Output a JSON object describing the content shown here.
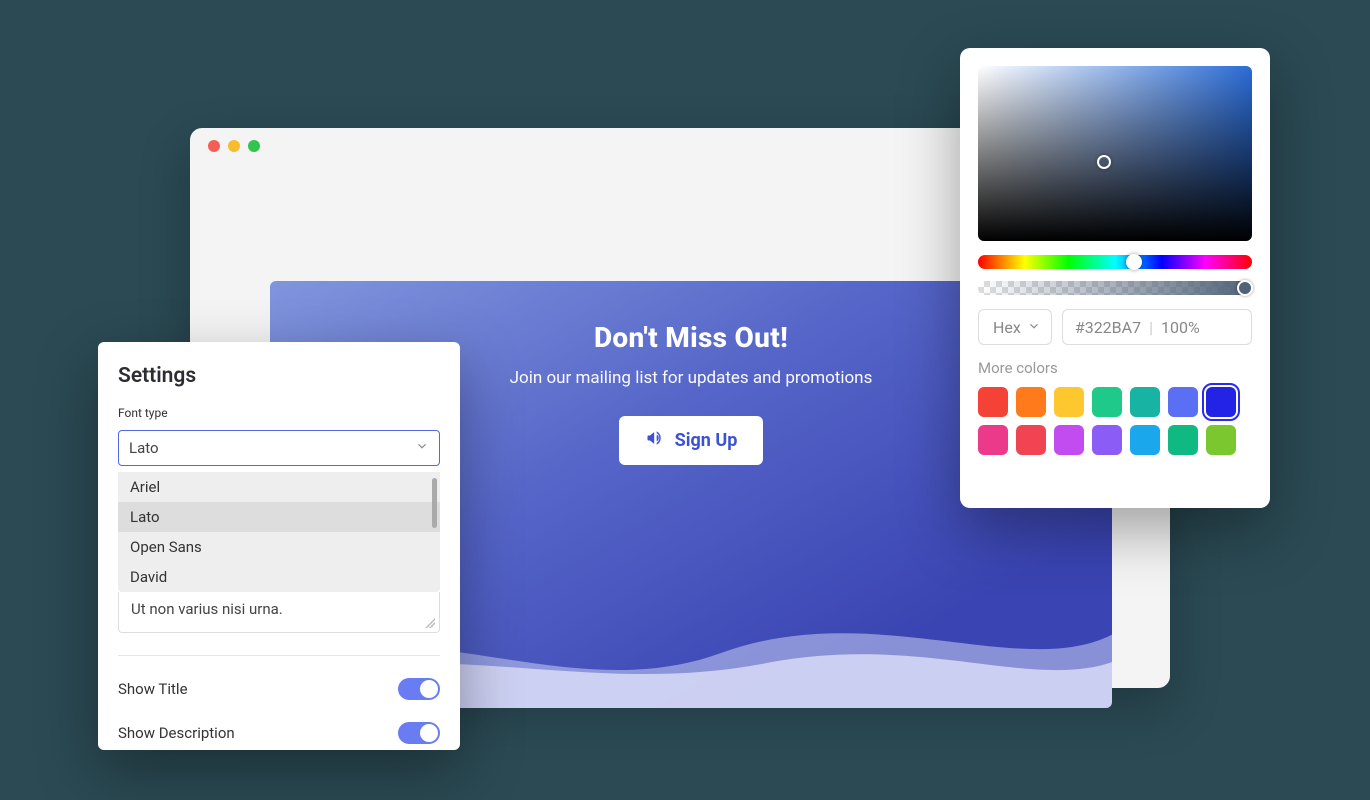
{
  "browser": {},
  "hero": {
    "title": "Don't Miss Out!",
    "subtitle": "Join our mailing list for updates and promotions",
    "button_label": "Sign Up"
  },
  "settings": {
    "heading": "Settings",
    "font_type_label": "Font type",
    "font_type_value": "Lato",
    "font_options": [
      "Ariel",
      "Lato",
      "Open Sans",
      "David"
    ],
    "font_selected_index": 1,
    "textarea_value": "Ut non varius nisi urna.",
    "show_title_label": "Show Title",
    "show_title_value": true,
    "show_description_label": "Show Description",
    "show_description_value": true
  },
  "picker": {
    "mode_label": "Hex",
    "hex_value": "#322BA7",
    "alpha_value": "100%",
    "more_colors_label": "More colors",
    "swatches_row1": [
      "#f44336",
      "#ff7a1a",
      "#fcc72f",
      "#1ec98a",
      "#17b3a3",
      "#5b6ff5",
      "#2323e6"
    ],
    "swatches_row2": [
      "#ec3a8b",
      "#f04452",
      "#c24cf0",
      "#8b5cf6",
      "#1aa7ec",
      "#10b981",
      "#7bc72f"
    ],
    "selected_swatch": "#2323e6"
  }
}
